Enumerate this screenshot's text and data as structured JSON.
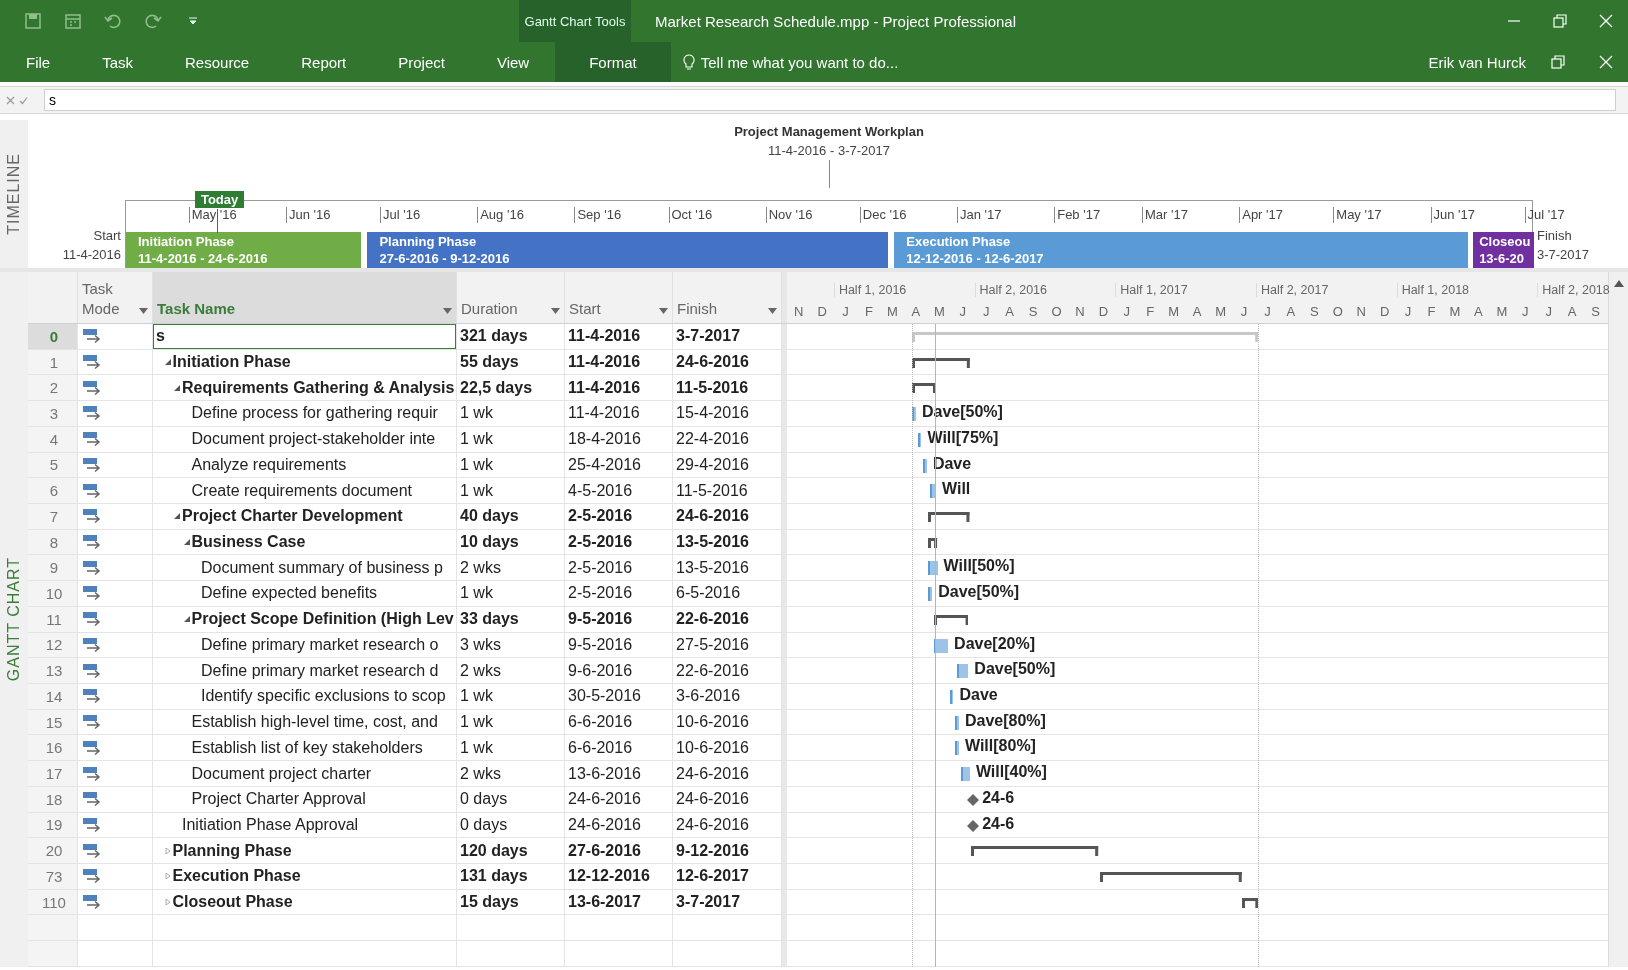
{
  "window": {
    "title": "Market Research Schedule.mpp - Project Professional",
    "context_label": "Gantt Chart Tools",
    "user": "Erik van Hurck"
  },
  "ribbon_tabs": [
    {
      "label": "File",
      "selected": false
    },
    {
      "label": "Task",
      "selected": false
    },
    {
      "label": "Resource",
      "selected": false
    },
    {
      "label": "Report",
      "selected": false
    },
    {
      "label": "Project",
      "selected": false
    },
    {
      "label": "View",
      "selected": false
    },
    {
      "label": "Format",
      "selected": true
    }
  ],
  "tell_me": {
    "placeholder": "Tell me what you want to do..."
  },
  "entry_bar": {
    "value": "s"
  },
  "timeline": {
    "side_label": "TIMELINE",
    "title": "Project Management Workplan",
    "date_range": "11-4-2016 - 3-7-2017",
    "start_label": "Start",
    "start_date": "11-4-2016",
    "finish_label": "Finish",
    "finish_date": "3-7-2017",
    "today_label": "Today",
    "months": [
      "May '16",
      "Jun '16",
      "Jul '16",
      "Aug '16",
      "Sep '16",
      "Oct '16",
      "Nov '16",
      "Dec '16",
      "Jan '17",
      "Feb '17",
      "Mar '17",
      "Apr '17",
      "May '17",
      "Jun '17",
      "Jul '17"
    ],
    "phases": [
      {
        "name": "Initiation Phase",
        "dates": "11-4-2016 - 24-6-2016",
        "color": "#70ad47"
      },
      {
        "name": "Planning Phase",
        "dates": "27-6-2016 - 9-12-2016",
        "color": "#4472c4"
      },
      {
        "name": "Execution Phase",
        "dates": "12-12-2016 - 12-6-2017",
        "color": "#5b9bd5"
      },
      {
        "name": "Closeou",
        "dates": "13-6-20",
        "color": "#7030a0"
      }
    ]
  },
  "gantt": {
    "side_label": "GANTT CHART",
    "columns": [
      {
        "label": "Task Mode",
        "selected": false
      },
      {
        "label": "Task Name",
        "selected": true
      },
      {
        "label": "Duration",
        "selected": false
      },
      {
        "label": "Start",
        "selected": false
      },
      {
        "label": "Finish",
        "selected": false
      }
    ],
    "halves": [
      "Half 1, 2016",
      "Half 2, 2016",
      "Half 1, 2017",
      "Half 2, 2017",
      "Half 1, 2018",
      "Half 2, 2018"
    ],
    "months": [
      "N",
      "D",
      "J",
      "F",
      "M",
      "A",
      "M",
      "J",
      "J",
      "A",
      "S",
      "O",
      "N",
      "D",
      "J",
      "F",
      "M",
      "A",
      "M",
      "J",
      "J",
      "A",
      "S",
      "O",
      "N",
      "D",
      "J",
      "F",
      "M",
      "A",
      "M",
      "J",
      "J",
      "A",
      "S"
    ],
    "rows": [
      {
        "id": "0",
        "name": "s",
        "kind": "project",
        "duration": "321 days",
        "start": "11-4-2016",
        "finish": "3-7-2017",
        "selected": true,
        "children": [
          {
            "id": "1",
            "name": "Initiation Phase",
            "kind": "summary",
            "expanded": true,
            "duration": "55 days",
            "start": "11-4-2016",
            "finish": "24-6-2016",
            "selected": false,
            "children": [
              {
                "id": "2",
                "name": "Requirements Gathering & Analysis",
                "kind": "summary",
                "expanded": true,
                "duration": "22,5 days",
                "start": "11-4-2016",
                "finish": "11-5-2016",
                "selected": false,
                "children": [
                  {
                    "id": "3",
                    "name": "Define process for gathering requir",
                    "kind": "task",
                    "duration": "1 wk",
                    "start": "11-4-2016",
                    "finish": "15-4-2016",
                    "bar_label": "Dave[50%]",
                    "selected": false
                  },
                  {
                    "id": "4",
                    "name": "Document project-stakeholder inte",
                    "kind": "task",
                    "duration": "1 wk",
                    "start": "18-4-2016",
                    "finish": "22-4-2016",
                    "bar_label": "Will[75%]",
                    "selected": false
                  },
                  {
                    "id": "5",
                    "name": "Analyze requirements",
                    "kind": "task",
                    "duration": "1 wk",
                    "start": "25-4-2016",
                    "finish": "29-4-2016",
                    "bar_label": "Dave",
                    "selected": false
                  },
                  {
                    "id": "6",
                    "name": "Create requirements document",
                    "kind": "task",
                    "duration": "1 wk",
                    "start": "4-5-2016",
                    "finish": "11-5-2016",
                    "bar_label": "Will",
                    "selected": false
                  }
                ]
              },
              {
                "id": "7",
                "name": "Project Charter Development",
                "kind": "summary",
                "expanded": true,
                "duration": "40 days",
                "start": "2-5-2016",
                "finish": "24-6-2016",
                "selected": false,
                "children": [
                  {
                    "id": "8",
                    "name": "Business Case",
                    "kind": "summary",
                    "expanded": true,
                    "duration": "10 days",
                    "start": "2-5-2016",
                    "finish": "13-5-2016",
                    "selected": false,
                    "children": [
                      {
                        "id": "9",
                        "name": "Document summary of business p",
                        "kind": "task",
                        "duration": "2 wks",
                        "start": "2-5-2016",
                        "finish": "13-5-2016",
                        "bar_label": "Will[50%]",
                        "selected": false
                      },
                      {
                        "id": "10",
                        "name": "Define expected benefits",
                        "kind": "task",
                        "duration": "1 wk",
                        "start": "2-5-2016",
                        "finish": "6-5-2016",
                        "bar_label": "Dave[50%]",
                        "selected": false
                      }
                    ]
                  },
                  {
                    "id": "11",
                    "name": "Project Scope Definition (High Lev",
                    "kind": "summary",
                    "expanded": true,
                    "duration": "33 days",
                    "start": "9-5-2016",
                    "finish": "22-6-2016",
                    "selected": false,
                    "children": [
                      {
                        "id": "12",
                        "name": "Define primary market research o",
                        "kind": "task",
                        "duration": "3 wks",
                        "start": "9-5-2016",
                        "finish": "27-5-2016",
                        "bar_label": "Dave[20%]",
                        "selected": false
                      },
                      {
                        "id": "13",
                        "name": "Define primary market research d",
                        "kind": "task",
                        "duration": "2 wks",
                        "start": "9-6-2016",
                        "finish": "22-6-2016",
                        "bar_label": "Dave[50%]",
                        "selected": false
                      },
                      {
                        "id": "14",
                        "name": "Identify specific exclusions to scop",
                        "kind": "task",
                        "duration": "1 wk",
                        "start": "30-5-2016",
                        "finish": "3-6-2016",
                        "bar_label": "Dave",
                        "selected": false
                      }
                    ]
                  },
                  {
                    "id": "15",
                    "name": "Establish high-level time, cost, and",
                    "kind": "task",
                    "duration": "1 wk",
                    "start": "6-6-2016",
                    "finish": "10-6-2016",
                    "bar_label": "Dave[80%]",
                    "selected": false
                  },
                  {
                    "id": "16",
                    "name": "Establish list of key stakeholders",
                    "kind": "task",
                    "duration": "1 wk",
                    "start": "6-6-2016",
                    "finish": "10-6-2016",
                    "bar_label": "Will[80%]",
                    "selected": false
                  },
                  {
                    "id": "17",
                    "name": "Document project charter",
                    "kind": "task",
                    "duration": "2 wks",
                    "start": "13-6-2016",
                    "finish": "24-6-2016",
                    "bar_label": "Will[40%]",
                    "selected": false
                  },
                  {
                    "id": "18",
                    "name": "Project Charter Approval",
                    "kind": "milestone",
                    "duration": "0 days",
                    "start": "24-6-2016",
                    "finish": "24-6-2016",
                    "bar_label": "24-6",
                    "selected": false
                  }
                ]
              },
              {
                "id": "19",
                "name": "Initiation Phase Approval",
                "kind": "milestone",
                "duration": "0 days",
                "start": "24-6-2016",
                "finish": "24-6-2016",
                "bar_label": "24-6",
                "selected": false
              }
            ]
          },
          {
            "id": "20",
            "name": "Planning Phase",
            "kind": "summary",
            "expanded": false,
            "duration": "120 days",
            "start": "27-6-2016",
            "finish": "9-12-2016",
            "selected": false
          },
          {
            "id": "73",
            "name": "Execution Phase",
            "kind": "summary",
            "expanded": false,
            "duration": "131 days",
            "start": "12-12-2016",
            "finish": "12-6-2017",
            "selected": false
          },
          {
            "id": "110",
            "name": "Closeout Phase",
            "kind": "summary",
            "expanded": false,
            "duration": "15 days",
            "start": "13-6-2017",
            "finish": "3-7-2017",
            "selected": false
          }
        ]
      }
    ]
  }
}
